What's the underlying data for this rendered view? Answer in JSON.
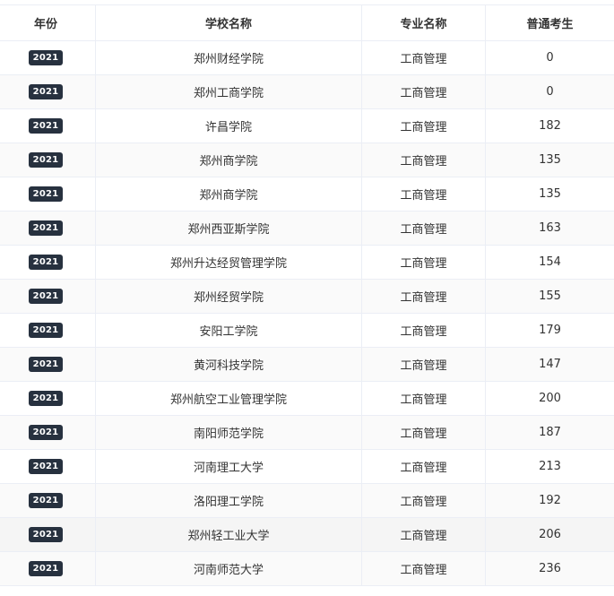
{
  "table": {
    "headers": [
      "年份",
      "学校名称",
      "专业名称",
      "普通考生"
    ],
    "rows": [
      {
        "year": "2021",
        "school": "郑州财经学院",
        "major": "工商管理",
        "count": "0"
      },
      {
        "year": "2021",
        "school": "郑州工商学院",
        "major": "工商管理",
        "count": "0"
      },
      {
        "year": "2021",
        "school": "许昌学院",
        "major": "工商管理",
        "count": "182"
      },
      {
        "year": "2021",
        "school": "郑州商学院",
        "major": "工商管理",
        "count": "135"
      },
      {
        "year": "2021",
        "school": "郑州商学院",
        "major": "工商管理",
        "count": "135"
      },
      {
        "year": "2021",
        "school": "郑州西亚斯学院",
        "major": "工商管理",
        "count": "163"
      },
      {
        "year": "2021",
        "school": "郑州升达经贸管理学院",
        "major": "工商管理",
        "count": "154"
      },
      {
        "year": "2021",
        "school": "郑州经贸学院",
        "major": "工商管理",
        "count": "155"
      },
      {
        "year": "2021",
        "school": "安阳工学院",
        "major": "工商管理",
        "count": "179"
      },
      {
        "year": "2021",
        "school": "黄河科技学院",
        "major": "工商管理",
        "count": "147"
      },
      {
        "year": "2021",
        "school": "郑州航空工业管理学院",
        "major": "工商管理",
        "count": "200"
      },
      {
        "year": "2021",
        "school": "南阳师范学院",
        "major": "工商管理",
        "count": "187"
      },
      {
        "year": "2021",
        "school": "河南理工大学",
        "major": "工商管理",
        "count": "213"
      },
      {
        "year": "2021",
        "school": "洛阳理工学院",
        "major": "工商管理",
        "count": "192"
      },
      {
        "year": "2021",
        "school": "郑州轻工业大学",
        "major": "工商管理",
        "count": "206"
      },
      {
        "year": "2021",
        "school": "河南师范大学",
        "major": "工商管理",
        "count": "236"
      }
    ]
  }
}
